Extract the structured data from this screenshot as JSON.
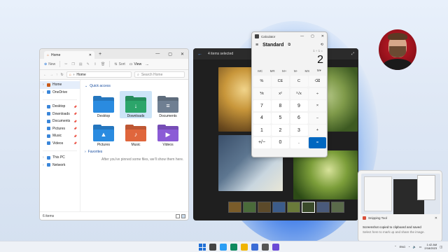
{
  "explorer": {
    "tab_title": "Home",
    "toolbar": {
      "new": "New",
      "sort": "Sort",
      "view": "View",
      "more": "..."
    },
    "address": "Home",
    "search_placeholder": "Search Home",
    "sidebar": [
      {
        "label": "Home",
        "icon": "home-icon",
        "active": true
      },
      {
        "label": "OneDrive",
        "icon": "cloud-icon"
      },
      {
        "label": "Desktop",
        "icon": "desktop-icon",
        "pinned": true
      },
      {
        "label": "Downloads",
        "icon": "download-icon",
        "pinned": true
      },
      {
        "label": "Documents",
        "icon": "documents-icon",
        "pinned": true
      },
      {
        "label": "Pictures",
        "icon": "pictures-icon",
        "pinned": true
      },
      {
        "label": "Music",
        "icon": "music-icon",
        "pinned": true
      },
      {
        "label": "Videos",
        "icon": "videos-icon",
        "pinned": true
      },
      {
        "label": "This PC",
        "icon": "pc-icon"
      },
      {
        "label": "Network",
        "icon": "network-icon"
      }
    ],
    "quick_access_title": "Quick access",
    "quick_access": [
      {
        "label": "Desktop",
        "color": "#2a8be0",
        "glyph": ""
      },
      {
        "label": "Downloads",
        "color": "#2ca56a",
        "glyph": "↓"
      },
      {
        "label": "Documents",
        "color": "#6f7f92",
        "glyph": "≡"
      },
      {
        "label": "Pictures",
        "color": "#2a8be0",
        "glyph": "▲"
      },
      {
        "label": "Music",
        "color": "#e0663c",
        "glyph": "♪"
      },
      {
        "label": "Videos",
        "color": "#8b5bd6",
        "glyph": "▶"
      }
    ],
    "favorites_title": "Favorites",
    "favorites_empty": "After you've pinned some files, we'll show them here.",
    "status": "6 items"
  },
  "photos": {
    "title": "4 items selected",
    "film_colors": [
      "#7a5c2a",
      "#4a6a3a",
      "#5c4a2a",
      "#3c5c8a",
      "#6a7a3a",
      "#3a4a2a",
      "#4a5a7a",
      "#5a6a4a"
    ]
  },
  "calculator": {
    "title": "Calculator",
    "mode": "Standard",
    "expression": "1 ÷ 1 =",
    "display": "2",
    "memory": [
      "MC",
      "MR",
      "M+",
      "M-",
      "MS",
      "M▾"
    ],
    "keys": [
      "%",
      "CE",
      "C",
      "⌫",
      "⅟x",
      "x²",
      "²√x",
      "÷",
      "7",
      "8",
      "9",
      "×",
      "4",
      "5",
      "6",
      "−",
      "1",
      "2",
      "3",
      "+",
      "+/−",
      "0",
      ".",
      "="
    ]
  },
  "notification": {
    "app": "Snipping Tool",
    "message": "Screenshot copied to clipboard and saved",
    "hint": "Select here to mark up and share the image."
  },
  "taskbar": {
    "icon_colors": [
      "#1f6fd6",
      "#444",
      "#2a9df4",
      "#0f8a5f",
      "#f0b400",
      "#3b6cd6",
      "#555",
      "#6a4ad6"
    ],
    "lang": "ENG",
    "time": "1:42 AM",
    "date": "2/18/2023"
  }
}
